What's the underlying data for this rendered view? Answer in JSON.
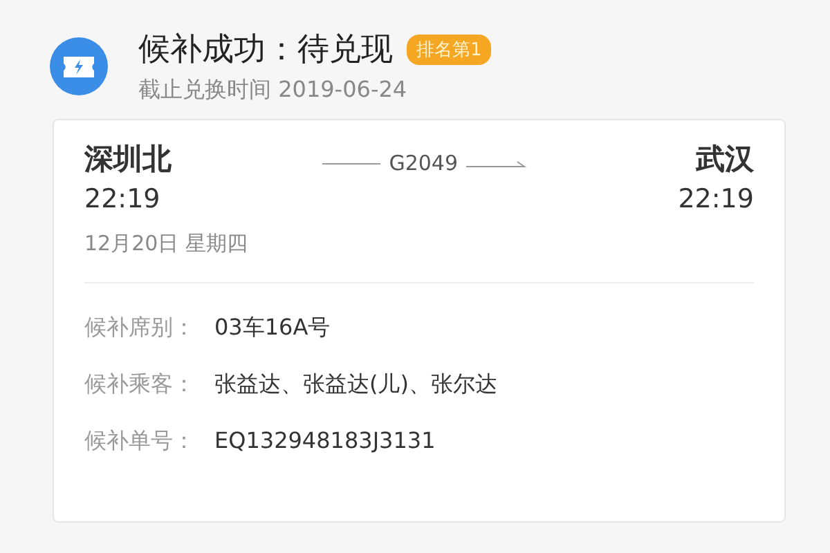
{
  "header": {
    "title": "候补成功：待兑现",
    "badge": "排名第1",
    "subtitle": "截止兑换时间 2019-06-24"
  },
  "trip": {
    "from": {
      "station": "深圳北",
      "time": "22:19"
    },
    "train": "G2049",
    "to": {
      "station": "武汉",
      "time": "22:19"
    },
    "date": "12月20日 星期四"
  },
  "details": [
    {
      "label": "候补席别：",
      "value": "03车16A号"
    },
    {
      "label": "候补乘客：",
      "value": "张益达、张益达(儿)、张尔达"
    },
    {
      "label": "候补单号：",
      "value": "EQ132948183J3131"
    }
  ]
}
